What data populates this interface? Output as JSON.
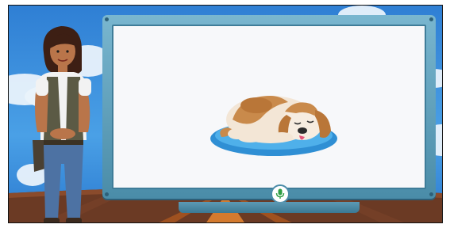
{
  "scene": {
    "background": "classroom-sky-backdrop",
    "colors": {
      "sky": "#3a8ddc",
      "board_frame": "#5b9bb7",
      "board_surface": "#f7f8fa",
      "mic_green": "#2f9e44",
      "floor": "#6b3a24"
    }
  },
  "board": {
    "image": "sleeping-dog-on-cushion"
  },
  "controls": {
    "mic_icon": "microphone-icon"
  },
  "character": {
    "name_icon": "teacher-character"
  }
}
